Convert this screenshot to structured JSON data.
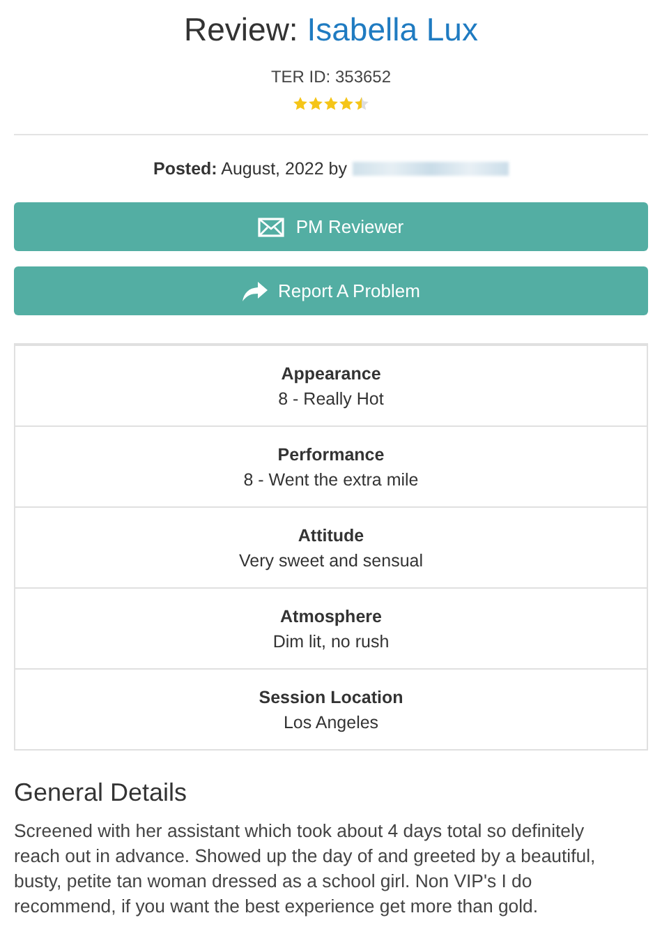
{
  "header": {
    "prefix": "Review:",
    "name": "Isabella Lux",
    "ter_id": "TER ID: 353652",
    "stars": 4.5
  },
  "posted": {
    "label": "Posted:",
    "text": "August, 2022 by"
  },
  "buttons": [
    {
      "kind": "mail",
      "label": "PM Reviewer"
    },
    {
      "kind": "share",
      "label": "Report A Problem"
    }
  ],
  "details": [
    {
      "label": "Appearance",
      "value": "8 - Really Hot"
    },
    {
      "label": "Performance",
      "value": "8 - Went the extra mile"
    },
    {
      "label": "Attitude",
      "value": "Very sweet and sensual"
    },
    {
      "label": "Atmosphere",
      "value": "Dim lit, no rush"
    },
    {
      "label": "Session Location",
      "value": "Los Angeles"
    }
  ],
  "general": {
    "heading": "General Details",
    "text": "Screened with her assistant which took about 4 days total so definitely reach out in advance. Showed up the day of and greeted by a beautiful, busty, petite tan woman dressed as a school girl. Non VIP's I do recommend, if you want the best experience get more than gold."
  }
}
